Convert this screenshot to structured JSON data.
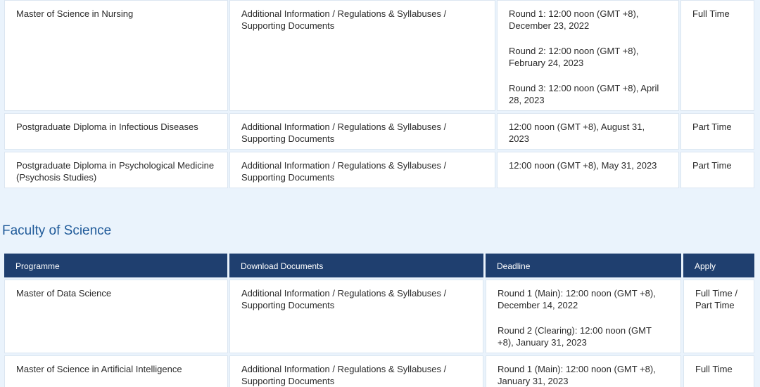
{
  "upper_rows": [
    {
      "programme": "Master of Science in Nursing",
      "docs_a": "Additional Information / Regulations & Syllabuses /",
      "docs_b": "Supporting Documents",
      "deadlines": [
        "Round 1: 12:00 noon (GMT +8), December 23, 2022",
        "Round 2: 12:00 noon (GMT +8), February 24, 2023",
        "Round 3: 12:00 noon (GMT +8), April 28, 2023"
      ],
      "apply": "Full Time"
    },
    {
      "programme": "Postgraduate Diploma in Infectious Diseases",
      "docs_a": "Additional Information / Regulations & Syllabuses /",
      "docs_b": "Supporting Documents",
      "deadlines": [
        "12:00 noon (GMT +8), August 31, 2023"
      ],
      "apply": "Part Time"
    },
    {
      "programme": "Postgraduate Diploma in Psychological Medicine (Psychosis Studies)",
      "docs_a": "Additional Information / Regulations & Syllabuses /",
      "docs_b": "Supporting Documents",
      "deadlines": [
        "12:00 noon (GMT +8), May 31, 2023"
      ],
      "apply": "Part Time"
    }
  ],
  "faculty_title": "Faculty of Science",
  "table_headers": {
    "programme": "Programme",
    "download": "Download Documents",
    "deadline": "Deadline",
    "apply": "Apply"
  },
  "science_rows": [
    {
      "programme": "Master of Data Science",
      "docs_a": "Additional Information / Regulations & Syllabuses /",
      "docs_b": "Supporting Documents",
      "deadlines": [
        "Round 1 (Main): 12:00 noon (GMT +8), December 14, 2022",
        "Round 2 (Clearing): 12:00 noon (GMT +8), January 31, 2023"
      ],
      "apply": "Full Time / Part Time"
    },
    {
      "programme": "Master of Science in Artificial Intelligence",
      "docs_a": "Additional Information / Regulations & Syllabuses /",
      "docs_b": "Supporting Documents",
      "deadlines": [
        "Round 1 (Main): 12:00 noon (GMT +8), January 31, 2023"
      ],
      "apply": "Full Time"
    }
  ],
  "colors": {
    "page_background": "#eaf3fc",
    "header_background": "#1f3f6f",
    "section_title": "#1f5a99"
  }
}
